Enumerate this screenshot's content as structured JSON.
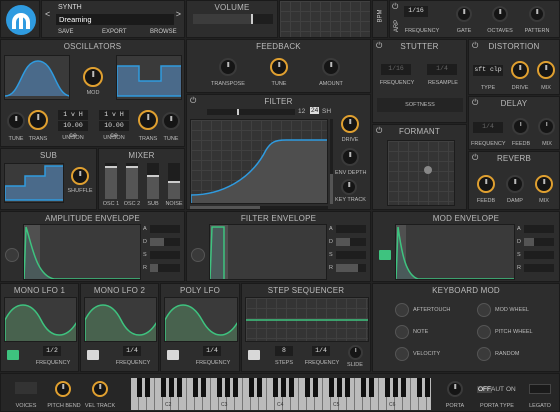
{
  "colors": {
    "accent": "#e0a030",
    "blue": "#2f9be0",
    "green": "#3ec37f",
    "bg": "#222222"
  },
  "patch": {
    "bank": "SYNTH",
    "name": "Dreaming",
    "save": "SAVE",
    "export": "EXPORT",
    "browse": "BROWSE",
    "prev": "<",
    "next": ">"
  },
  "volume": {
    "title": "VOLUME"
  },
  "bpm": "BPM",
  "arp": "ARP",
  "arp_controls": {
    "frequency": "FREQUENCY",
    "gate": "GATE",
    "octaves": "OCTAVES",
    "pattern": "PATTERN",
    "freq_value": "1/16"
  },
  "osc": {
    "title": "OSCILLATORS",
    "mod": "MOD",
    "tune": "TUNE",
    "trans": "TRANS",
    "unison": "UNISON",
    "unison1": "1 v H",
    "unison2": "1 v H",
    "cents1": "10.00 ce",
    "cents2": "10.00 ce"
  },
  "feedback": {
    "title": "FEEDBACK",
    "transpose": "TRANSPOSE",
    "tune": "TUNE",
    "amount": "AMOUNT"
  },
  "stutter": {
    "title": "STUTTER",
    "frequency": "FREQUENCY",
    "resample": "RESAMPLE",
    "softness": "SOFTNESS",
    "freq_value": "1/16",
    "resample_value": "1/4"
  },
  "distortion": {
    "title": "DISTORTION",
    "type_value": "sft clp",
    "type": "TYPE",
    "drive": "DRIVE",
    "mix": "MIX"
  },
  "filter": {
    "title": "FILTER",
    "slope12": "12",
    "slope24": "24",
    "sh": "SH",
    "drive": "DRIVE",
    "env_depth": "ENV DEPTH",
    "key_track": "KEY TRACK"
  },
  "formant": {
    "title": "FORMANT"
  },
  "delay": {
    "title": "DELAY",
    "frequency": "FREQUENCY",
    "feedb": "FEEDB",
    "mix": "MIX",
    "freq_value": "1/4"
  },
  "reverb": {
    "title": "REVERB",
    "feedb": "FEEDB",
    "damp": "DAMP",
    "mix": "MIX"
  },
  "sub": {
    "title": "SUB",
    "shuffle": "SHUFFLE"
  },
  "mixer": {
    "title": "MIXER",
    "osc1": "OSC 1",
    "osc2": "OSC 2",
    "sub": "SUB",
    "noise": "NOISE",
    "levels": [
      0.85,
      0.85,
      0.6,
      0.45
    ]
  },
  "amp_env": {
    "title": "AMPLITUDE ENVELOPE"
  },
  "filter_env": {
    "title": "FILTER ENVELOPE"
  },
  "mod_env": {
    "title": "MOD ENVELOPE"
  },
  "adsr": {
    "a": "A",
    "d": "D",
    "s": "S",
    "r": "R"
  },
  "lfo1": {
    "title": "MONO LFO 1",
    "freq_value": "1/2",
    "frequency": "FREQUENCY"
  },
  "lfo2": {
    "title": "MONO LFO 2",
    "freq_value": "1/4",
    "frequency": "FREQUENCY"
  },
  "lfo3": {
    "title": "POLY LFO",
    "freq_value": "1/4",
    "frequency": "FREQUENCY"
  },
  "step_seq": {
    "title": "STEP SEQUENCER",
    "steps_value": "8",
    "steps": "STEPS",
    "freq_value": "1/4",
    "frequency": "FREQUENCY",
    "slide": "SLIDE"
  },
  "keyboard_mod": {
    "title": "KEYBOARD MOD",
    "aftertouch": "AFTERTOUCH",
    "mod_wheel": "MOD WHEEL",
    "note": "NOTE",
    "pitch_wheel": "PITCH WHEEL",
    "velocity": "VELOCITY",
    "random": "RANDOM"
  },
  "bottom": {
    "voices": "VOICES",
    "pitch_bend": "PITCH BEND",
    "vel_track": "VEL TRACK",
    "porta": "PORTA",
    "porta_type": "PORTA TYPE",
    "legato": "LEGATO",
    "off": "OFF",
    "aut": "AUT",
    "on": "ON",
    "keys": [
      "C2",
      "C3",
      "C4",
      "C5",
      "C6",
      "C7"
    ]
  }
}
